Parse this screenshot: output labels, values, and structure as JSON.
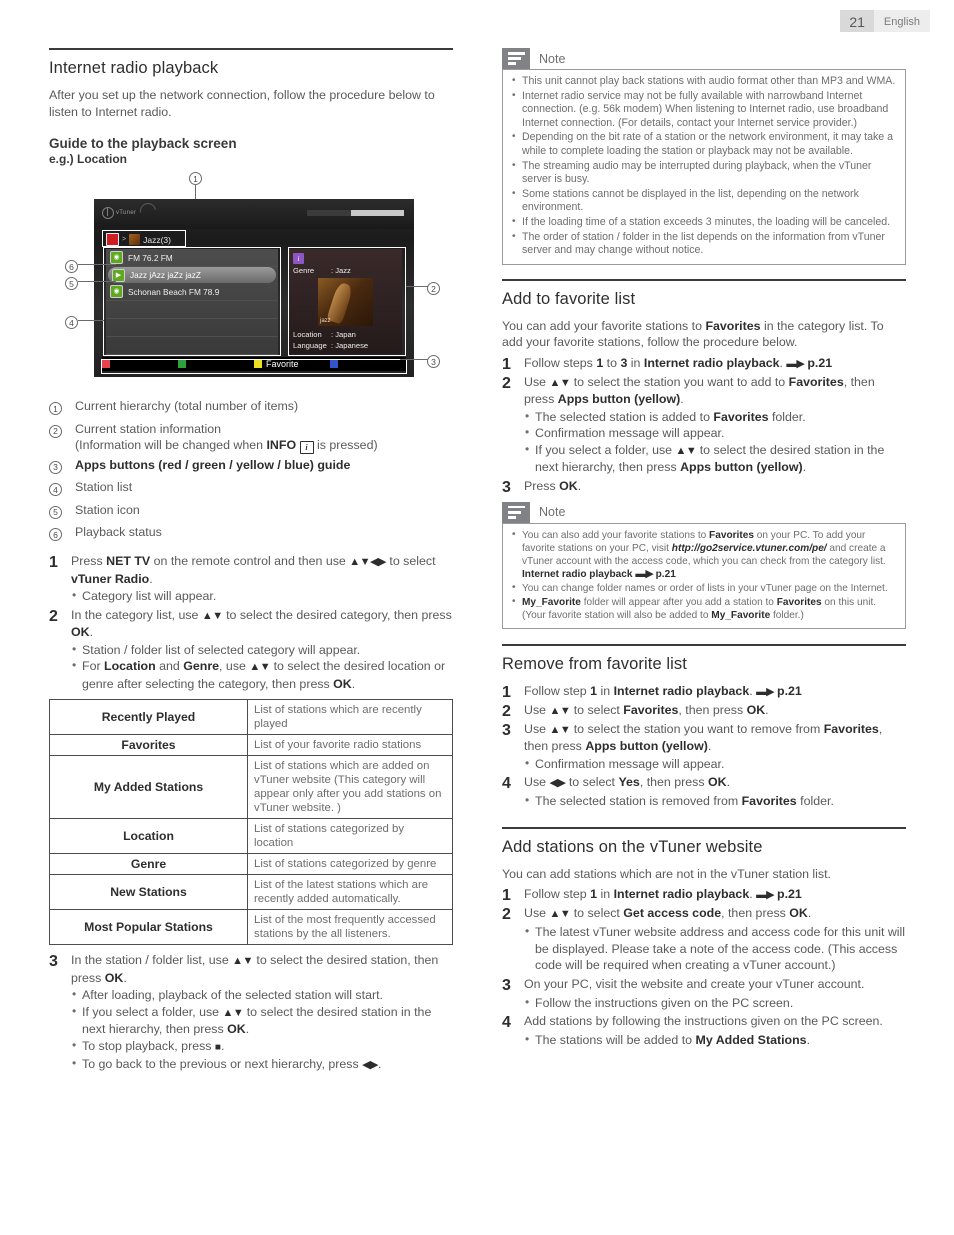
{
  "header": {
    "page_number": "21",
    "language": "English"
  },
  "left": {
    "section_title": "Internet radio playback",
    "intro": "After you set up the network connection, follow the procedure below to listen to Internet radio.",
    "sub_title": "Guide to the playback screen",
    "example_label": "e.g.) Location",
    "tv": {
      "logo_text": "vTuner",
      "breadcrumb": "Jazz(3)",
      "breadcrumb_separator": ">",
      "stations": [
        {
          "label": "FM 76.2 FM",
          "icon": "radio-station-icon",
          "selected": false
        },
        {
          "label": "Jazz jAzz jaZz jazZ",
          "icon": "play-status-icon",
          "selected": true
        },
        {
          "label": "Schonan Beach FM 78.9",
          "icon": "radio-station-icon",
          "selected": false
        }
      ],
      "info": {
        "badge": "i",
        "genre_key": "Genre",
        "genre_value": ": Jazz",
        "art_label": "jazz",
        "location_key": "Location",
        "location_value": ": Japan",
        "language_key": "Language",
        "language_value": ": Japanese"
      },
      "apps_bar": {
        "red": "#e8434c",
        "green": "#2fa03a",
        "yellow": "#e8e020",
        "blue": "#3355cc",
        "yellow_label": "Favorite"
      }
    },
    "legend": [
      {
        "num": "1",
        "text": "Current hierarchy (total number of items)"
      },
      {
        "num": "2",
        "text": "Current station information"
      },
      {
        "num": "3",
        "text": "Apps buttons (red / green / yellow / blue) guide"
      },
      {
        "num": "4",
        "text": "Station list"
      },
      {
        "num": "5",
        "text": "Station icon"
      },
      {
        "num": "6",
        "text": "Playback status"
      }
    ],
    "legend_2_sub_pre": "(Information will be changed when ",
    "legend_2_sub_bold": "INFO",
    "legend_2_sub_post": " is pressed)",
    "steps": [
      {
        "num": "1",
        "text_html": "Press <b>NET TV</b> on the remote control and then use <span class=\"ar\">▲▼◀▶</span> to select <b>vTuner Radio</b>.",
        "bullets": [
          "Category list will appear."
        ]
      },
      {
        "num": "2",
        "text_html": "In the category list, use <span class=\"ar\">▲▼</span> to select the desired category, then press <b>OK</b>.",
        "bullets": [
          "Station / folder list of selected category will appear.",
          "For <b>Location</b> and <b>Genre</b>, use <span class=\"ar\">▲▼</span> to select the desired location or genre after selecting the category, then press <b>OK</b>."
        ]
      }
    ],
    "category_table": [
      {
        "name": "Recently Played",
        "desc": "List of stations which are recently played"
      },
      {
        "name": "Favorites",
        "desc": "List of your favorite radio stations"
      },
      {
        "name": "My Added Stations",
        "desc": "List of stations which are added on vTuner website (This category will appear only after you add stations on vTuner website. )"
      },
      {
        "name": "Location",
        "desc": "List of stations categorized by location"
      },
      {
        "name": "Genre",
        "desc": "List of stations categorized by genre"
      },
      {
        "name": "New Stations",
        "desc": "List of the latest stations which are recently added automatically."
      },
      {
        "name": "Most Popular Stations",
        "desc": "List of the most frequently accessed stations by the all listeners."
      }
    ],
    "step3": {
      "num": "3",
      "text_html": "In the station / folder list, use <span class=\"ar\">▲▼</span> to select the desired station, then press <b>OK</b>.",
      "bullets": [
        "After loading, playback of the selected station will start.",
        "If you select a folder, use <span class=\"ar\">▲▼</span> to select the desired station in the next hierarchy, then press <b>OK</b>.",
        "To stop playback, press <span class=\"sq\">■</span>.",
        "To go back to the previous or next hierarchy, press <span class=\"ar\">◀▶</span>."
      ]
    }
  },
  "right": {
    "note1": {
      "title": "Note",
      "items": [
        "This unit cannot play back stations with audio format other than MP3 and WMA.",
        "Internet radio service may not be fully available with narrowband Internet connection. (e.g. 56k modem) When listening to Internet radio, use broadband Internet connection. (For details, contact your Internet service provider.)",
        "Depending on the bit rate of a station or the network environment, it may take a while to complete loading the station or playback may not be available.",
        "The streaming audio may be interrupted during playback, when the vTuner server is busy.",
        "Some stations cannot be displayed in the list, depending on the network environment.",
        "If the loading time of a station exceeds 3 minutes, the loading will be canceled.",
        "The order of station / folder in the list depends on the information from vTuner server and may change without notice."
      ]
    },
    "add_fav": {
      "title": "Add to favorite list",
      "intro_html": "You can add your favorite stations to <b>Favorites</b> in the category list. To add your favorite stations, follow the procedure below.",
      "steps": [
        {
          "num": "1",
          "text_html": "Follow steps <b>1</b> to <b>3</b> in <b>Internet radio playback</b>. <span class=\"gotoarrow\">▬▶</span> <b>p.21</b>",
          "bullets": []
        },
        {
          "num": "2",
          "text_html": "Use <span class=\"ar\">▲▼</span> to select the station you want to add to <b>Favorites</b>, then press <b>Apps button (yellow)</b>.",
          "bullets": [
            "The selected station is added to <b>Favorites</b> folder.",
            "Confirmation message will appear.",
            "If you select a folder, use <span class=\"ar\">▲▼</span> to select the desired station in the next hierarchy, then press <b>Apps button (yellow)</b>."
          ]
        },
        {
          "num": "3",
          "text_html": "Press <b>OK</b>.",
          "bullets": []
        }
      ]
    },
    "note2": {
      "title": "Note",
      "items_html": [
        "You can also add your favorite stations to <b>Favorites</b> on your PC. To add your favorite stations on your PC, visit <i class=\"url\">http://go2service.vtuner.com/pe/</i> and create a vTuner account with the access code, which you can check from the category list. <b>Internet radio playback</b> <span class=\"gotoarrow\">▬▶</span> <b>p.21</b>",
        "You can change folder names or order of lists in your vTuner page on the Internet.",
        "<b>My_Favorite</b> folder will appear after you add a station to <b>Favorites</b> on this unit. (Your favorite station will also be added to <b>My_Favorite</b> folder.)"
      ]
    },
    "remove_fav": {
      "title": "Remove from favorite list",
      "steps": [
        {
          "num": "1",
          "text_html": "Follow step <b>1</b> in <b>Internet radio playback</b>. <span class=\"gotoarrow\">▬▶</span> <b>p.21</b>",
          "bullets": []
        },
        {
          "num": "2",
          "text_html": "Use <span class=\"ar\">▲▼</span> to select <b>Favorites</b>, then press <b>OK</b>.",
          "bullets": []
        },
        {
          "num": "3",
          "text_html": "Use <span class=\"ar\">▲▼</span> to select the station you want to remove from <b>Favorites</b>, then press <b>Apps button (yellow)</b>.",
          "bullets": [
            "Confirmation message will appear."
          ]
        },
        {
          "num": "4",
          "text_html": "Use <span class=\"ar\">◀▶</span> to select <b>Yes</b>, then press <b>OK</b>.",
          "bullets": [
            "The selected station is removed from <b>Favorites</b> folder."
          ]
        }
      ]
    },
    "add_stations": {
      "title": "Add stations on the vTuner website",
      "intro": "You can add stations which are not in the vTuner station list.",
      "steps": [
        {
          "num": "1",
          "text_html": "Follow step <b>1</b> in <b>Internet radio playback</b>. <span class=\"gotoarrow\">▬▶</span> <b>p.21</b>",
          "bullets": []
        },
        {
          "num": "2",
          "text_html": "Use <span class=\"ar\">▲▼</span> to select <b>Get access code</b>, then press <b>OK</b>.",
          "bullets": [
            "The latest vTuner website address and access code for this unit will be displayed. Please take a note of the access code. (This access code will be required when creating a vTuner account.)"
          ]
        },
        {
          "num": "3",
          "text_html": "On your PC, visit the website and create your vTuner account.",
          "bullets": [
            "Follow the instructions given on the PC screen."
          ]
        },
        {
          "num": "4",
          "text_html": "Add stations by following the instructions given on the PC screen.",
          "bullets": [
            "The stations will be added to <b>My Added Stations</b>."
          ]
        }
      ]
    }
  }
}
